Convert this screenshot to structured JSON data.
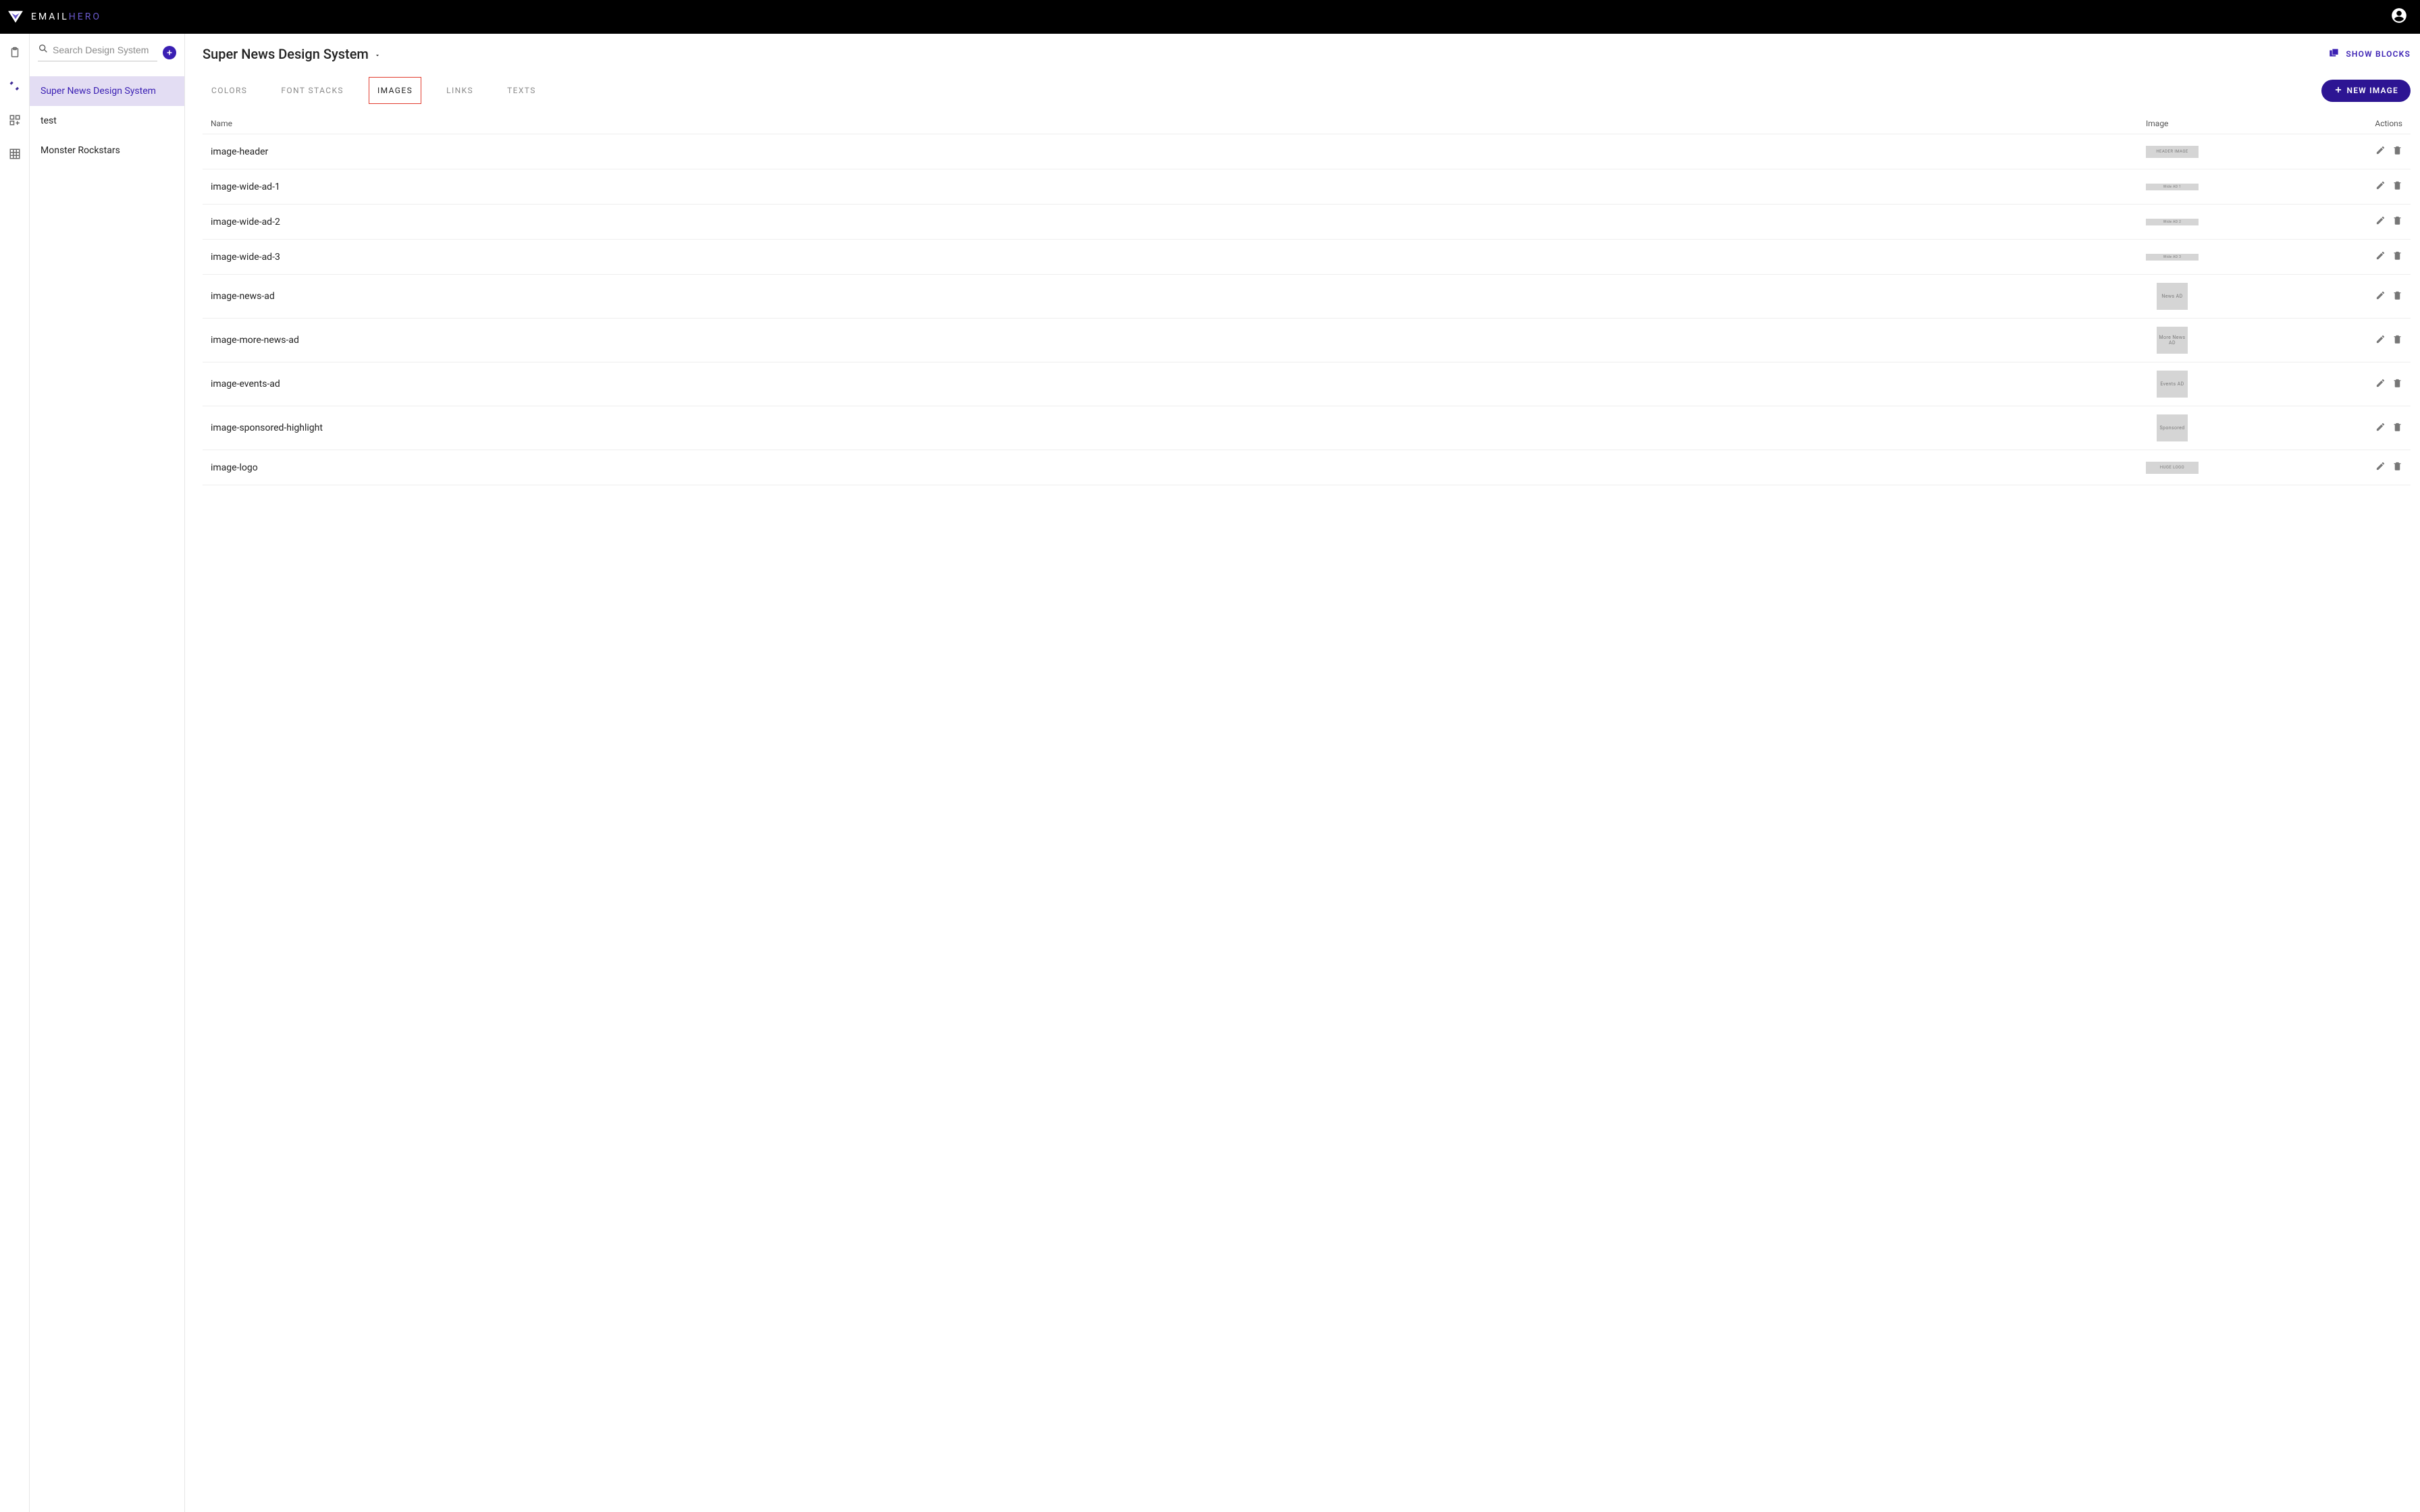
{
  "brand": {
    "email": "EMAIL",
    "hero": "HERO"
  },
  "search": {
    "placeholder": "Search Design System"
  },
  "rail": {
    "items": [
      "clipboard",
      "tools",
      "module-add",
      "grid"
    ]
  },
  "sidebar": {
    "items": [
      {
        "label": "Super News Design System",
        "active": true
      },
      {
        "label": "test",
        "active": false
      },
      {
        "label": "Monster Rockstars",
        "active": false
      }
    ]
  },
  "page_title": "Super News Design System",
  "show_blocks_label": "SHOW BLOCKS",
  "tabs": [
    {
      "label": "COLORS",
      "active": false
    },
    {
      "label": "FONT STACKS",
      "active": false
    },
    {
      "label": "IMAGES",
      "active": true
    },
    {
      "label": "LINKS",
      "active": false
    },
    {
      "label": "TEXTS",
      "active": false
    }
  ],
  "new_image_label": "NEW IMAGE",
  "table": {
    "headers": {
      "name": "Name",
      "image": "Image",
      "actions": "Actions"
    },
    "rows": [
      {
        "name": "image-header",
        "thumb_label": "HEADER IMAGE",
        "shape": "wide"
      },
      {
        "name": "image-wide-ad-1",
        "thumb_label": "Wide AD 1",
        "shape": "wide-narrow"
      },
      {
        "name": "image-wide-ad-2",
        "thumb_label": "Wide AD 2",
        "shape": "wide-narrow"
      },
      {
        "name": "image-wide-ad-3",
        "thumb_label": "Wide AD 3",
        "shape": "wide-narrow"
      },
      {
        "name": "image-news-ad",
        "thumb_label": "News AD",
        "shape": "square"
      },
      {
        "name": "image-more-news-ad",
        "thumb_label": "More News AD",
        "shape": "square"
      },
      {
        "name": "image-events-ad",
        "thumb_label": "Events AD",
        "shape": "square"
      },
      {
        "name": "image-sponsored-highlight",
        "thumb_label": "Sponsored",
        "shape": "square"
      },
      {
        "name": "image-logo",
        "thumb_label": "HUGE LOGO",
        "shape": "wide"
      }
    ]
  }
}
